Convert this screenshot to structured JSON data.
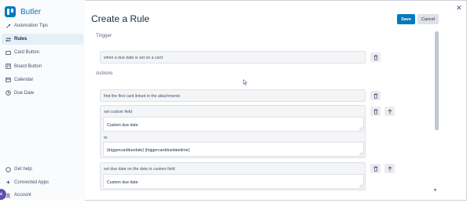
{
  "app": {
    "name": "Butler"
  },
  "sidebar": {
    "items": [
      {
        "label": "Automation Tips",
        "icon": "lightbulb-icon"
      },
      {
        "label": "Rules",
        "icon": "rules-icon",
        "active": true
      },
      {
        "label": "Card Button",
        "icon": "card-icon"
      },
      {
        "label": "Board Button",
        "icon": "board-icon"
      },
      {
        "label": "Calendar",
        "icon": "calendar-icon"
      },
      {
        "label": "Due Date",
        "icon": "clock-icon"
      }
    ],
    "bottom_items": [
      {
        "label": "Get help",
        "icon": "help-icon"
      },
      {
        "label": "Connected Apps",
        "icon": "apps-icon"
      },
      {
        "label": "Account",
        "icon": "account-icon"
      }
    ]
  },
  "page": {
    "title": "Create a Rule",
    "save_label": "Save",
    "cancel_label": "Cancel"
  },
  "trigger": {
    "heading": "Trigger",
    "text": "when a due date is set on a card"
  },
  "actions": {
    "heading": "Actions",
    "items": [
      {
        "text": "find the first card linked in the attachments"
      },
      {
        "text": "set custom field",
        "field_value": "Custom due date",
        "connector": "to",
        "value": "{triggercardduedate} {triggercardduedatetime}"
      },
      {
        "text": "set due date on the date in custom field",
        "field_value": "Custom due date"
      }
    ]
  },
  "colors": {
    "accent": "#0079bf",
    "active_nav_bg": "#e4f0f6",
    "card_bg": "#f4f5f7"
  }
}
